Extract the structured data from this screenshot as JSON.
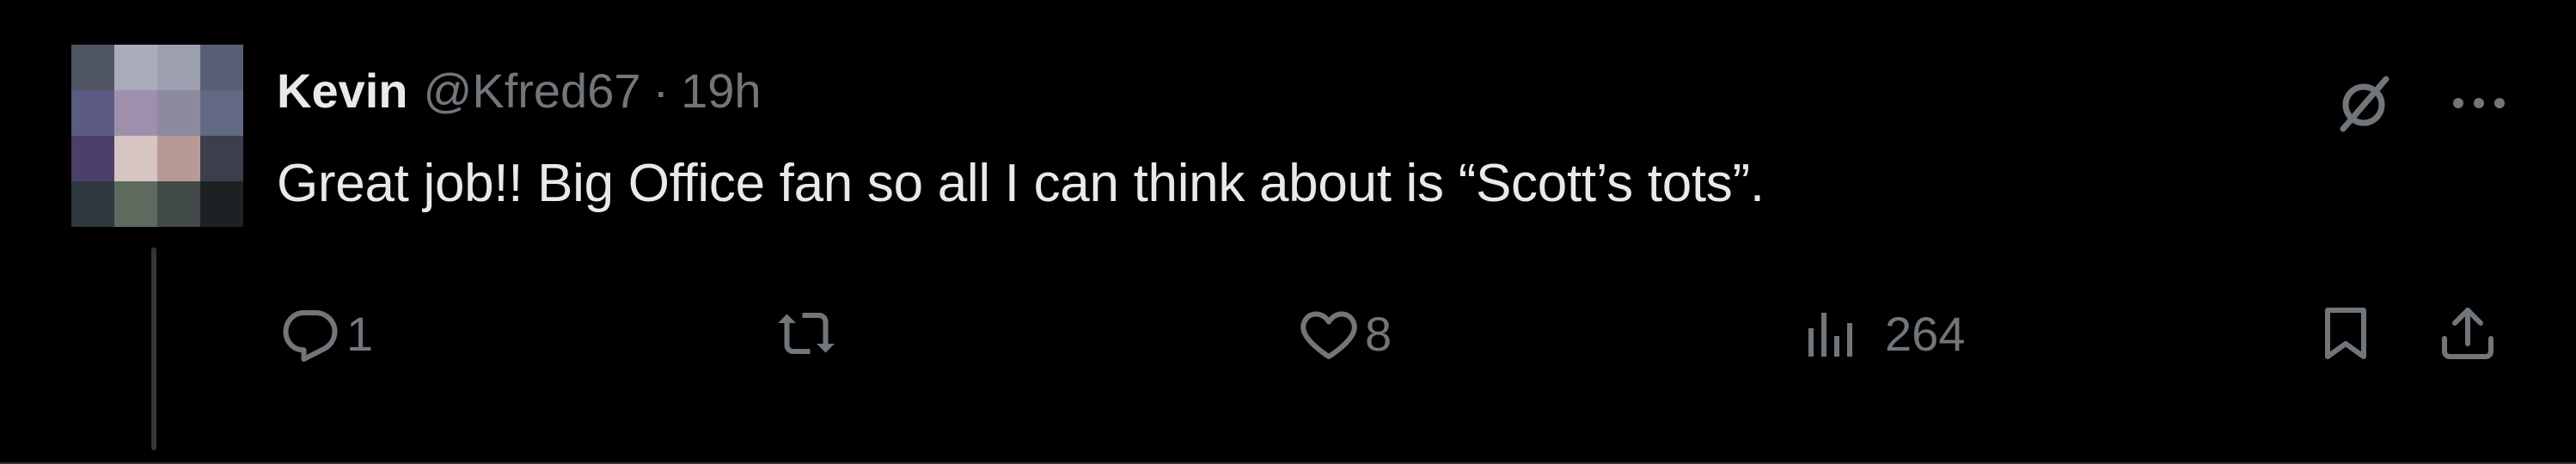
{
  "author": {
    "display_name": "Kevin",
    "handle": "@Kfred67",
    "separator": "·",
    "time": "19h"
  },
  "tweet": {
    "text": "Great job!! Big Office fan so all I can think about is “Scott’s tots”."
  },
  "actions": {
    "reply_count": "1",
    "like_count": "8",
    "views_count": "264"
  },
  "icons": {
    "top_right": [
      "grok-icon",
      "more-icon"
    ],
    "action_bar": [
      "reply-icon",
      "retweet-icon",
      "like-icon",
      "views-icon",
      "bookmark-icon",
      "share-icon"
    ]
  },
  "colors": {
    "background": "#000000",
    "text_primary": "#e7e9ea",
    "text_secondary": "#71767b",
    "divider": "#2f3336"
  }
}
